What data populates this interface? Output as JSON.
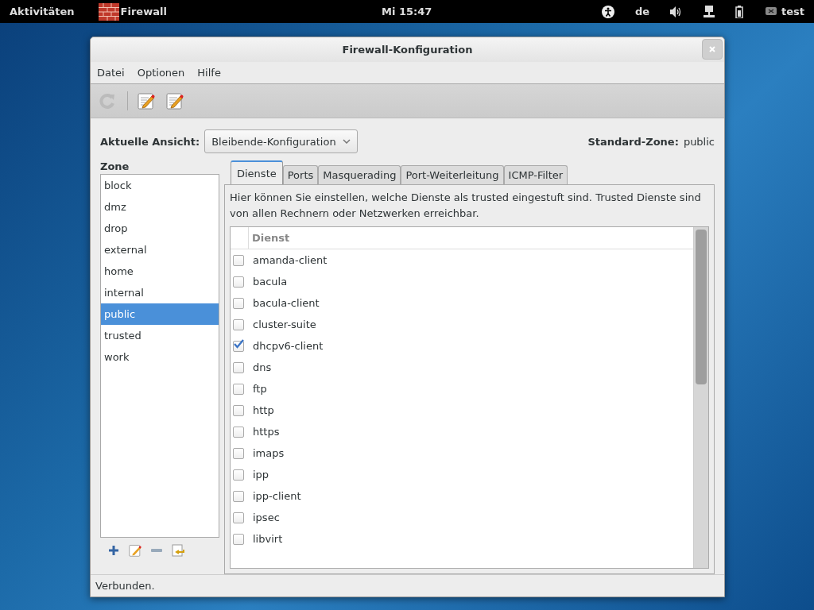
{
  "top_bar": {
    "activities": "Aktivitäten",
    "app_name": "Firewall",
    "clock": "Mi 15:47",
    "keyboard": "de",
    "user": "test"
  },
  "window": {
    "title": "Firewall-Konfiguration"
  },
  "menu": [
    "Datei",
    "Optionen",
    "Hilfe"
  ],
  "view": {
    "label": "Aktuelle Ansicht:",
    "value": "Bleibende-Konfiguration"
  },
  "default_zone": {
    "label": "Standard-Zone:",
    "value": "public"
  },
  "zones": {
    "title": "Zone",
    "items": [
      {
        "name": "block",
        "selected": false
      },
      {
        "name": "dmz",
        "selected": false
      },
      {
        "name": "drop",
        "selected": false
      },
      {
        "name": "external",
        "selected": false
      },
      {
        "name": "home",
        "selected": false
      },
      {
        "name": "internal",
        "selected": false
      },
      {
        "name": "public",
        "selected": true
      },
      {
        "name": "trusted",
        "selected": false
      },
      {
        "name": "work",
        "selected": false
      }
    ]
  },
  "tabs": [
    {
      "label": "Dienste",
      "selected": true
    },
    {
      "label": "Ports",
      "selected": false
    },
    {
      "label": "Masquerading",
      "selected": false
    },
    {
      "label": "Port-Weiterleitung",
      "selected": false
    },
    {
      "label": "ICMP-Filter",
      "selected": false
    }
  ],
  "description": "Hier können Sie einstellen, welche Dienste als trusted eingestuft sind. Trusted Dienste sind von allen Rechnern oder Netzwerken erreichbar.",
  "services": {
    "column": "Dienst",
    "rows": [
      {
        "name": "amanda-client",
        "checked": false
      },
      {
        "name": "bacula",
        "checked": false
      },
      {
        "name": "bacula-client",
        "checked": false
      },
      {
        "name": "cluster-suite",
        "checked": false
      },
      {
        "name": "dhcpv6-client",
        "checked": true
      },
      {
        "name": "dns",
        "checked": false
      },
      {
        "name": "ftp",
        "checked": false
      },
      {
        "name": "http",
        "checked": false
      },
      {
        "name": "https",
        "checked": false
      },
      {
        "name": "imaps",
        "checked": false
      },
      {
        "name": "ipp",
        "checked": false
      },
      {
        "name": "ipp-client",
        "checked": false
      },
      {
        "name": "ipsec",
        "checked": false
      },
      {
        "name": "libvirt",
        "checked": false
      }
    ]
  },
  "status_bar": "Verbunden."
}
